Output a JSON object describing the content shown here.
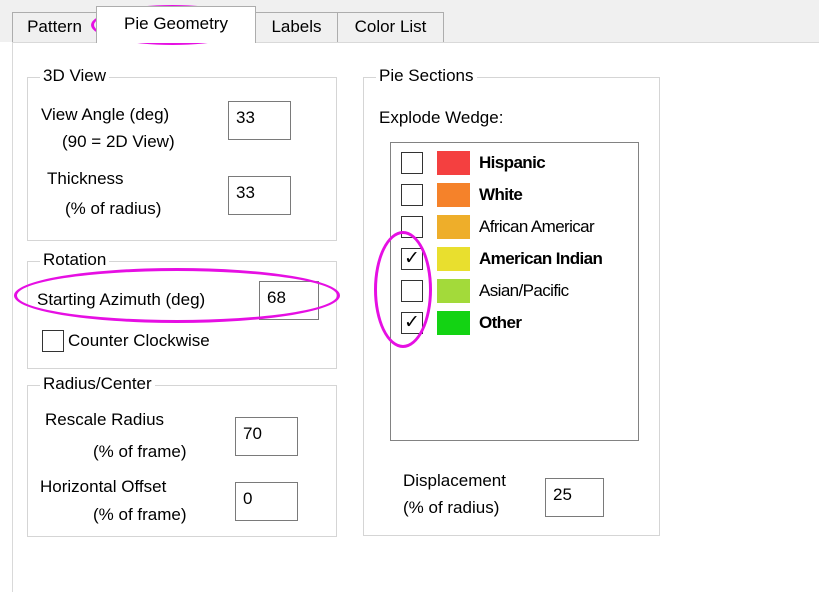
{
  "tabs": [
    {
      "label": "Pattern"
    },
    {
      "label": "Pie Geometry"
    },
    {
      "label": "Labels"
    },
    {
      "label": "Color List"
    }
  ],
  "view3d": {
    "legend": "3D View",
    "view_angle_label": "View Angle (deg)",
    "view_angle_sub": "(90 = 2D View)",
    "view_angle_value": "33",
    "thickness_label": "Thickness",
    "thickness_sub": "(% of radius)",
    "thickness_value": "33"
  },
  "rotation": {
    "legend": "Rotation",
    "azimuth_label": "Starting Azimuth (deg)",
    "azimuth_value": "68",
    "ccw_label": "Counter Clockwise",
    "ccw_checked": false
  },
  "radius_center": {
    "legend": "Radius/Center",
    "rescale_label": "Rescale Radius",
    "rescale_sub": "(% of frame)",
    "rescale_value": "70",
    "hoffset_label": "Horizontal Offset",
    "hoffset_sub": "(% of frame)",
    "hoffset_value": "0"
  },
  "pie_sections": {
    "legend": "Pie Sections",
    "explode_label": "Explode Wedge:",
    "items": [
      {
        "label": "Hispanic",
        "color": "#f44040",
        "checked": false,
        "bold": true,
        "check": ""
      },
      {
        "label": "White",
        "color": "#f5822a",
        "checked": false,
        "bold": true,
        "check": ""
      },
      {
        "label": "African Americar",
        "color": "#eeae2a",
        "checked": false,
        "bold": false,
        "check": ""
      },
      {
        "label": "American Indian",
        "color": "#e9df2e",
        "checked": true,
        "bold": true,
        "check": "✓"
      },
      {
        "label": "Asian/Pacific",
        "color": "#a3da3a",
        "checked": false,
        "bold": false,
        "check": ""
      },
      {
        "label": "Other",
        "color": "#13d313",
        "checked": true,
        "bold": true,
        "check": "✓"
      }
    ],
    "displacement_label": "Displacement",
    "displacement_sub": "(% of radius)",
    "displacement_value": "25"
  },
  "colors": {
    "annotation": "#e60fe3"
  }
}
